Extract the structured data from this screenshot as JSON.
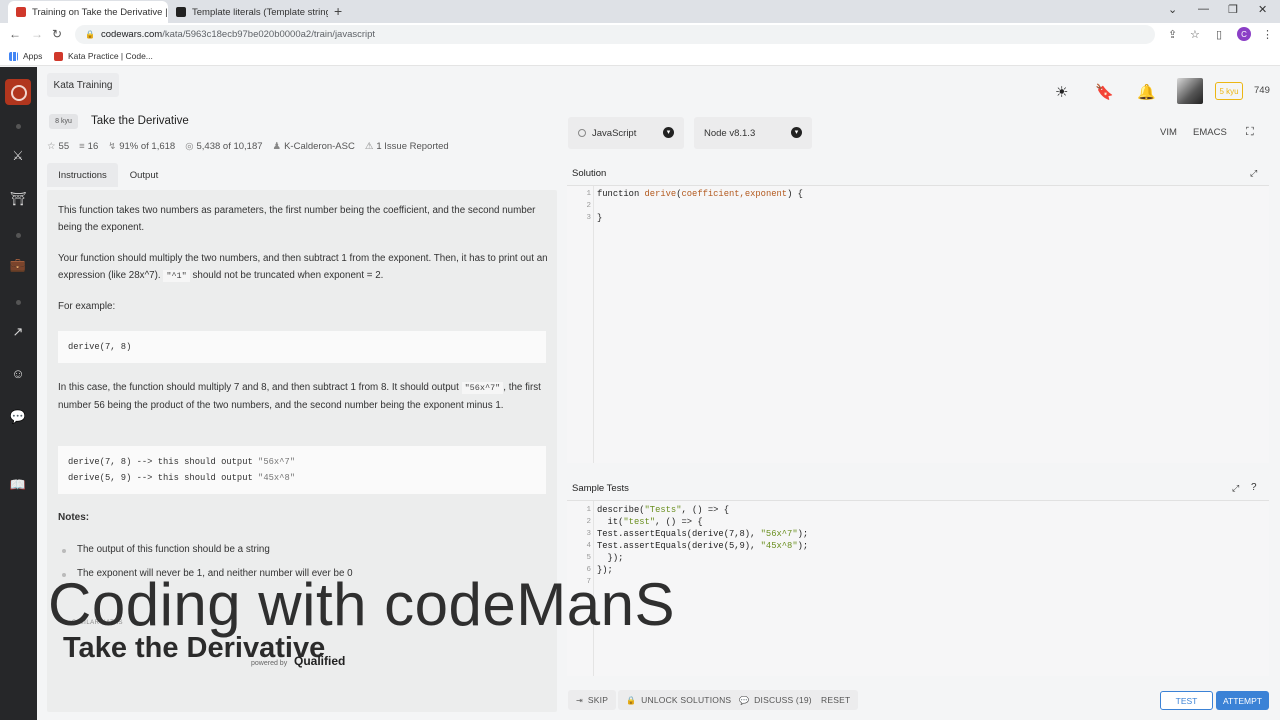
{
  "browser": {
    "tabs": [
      {
        "title": "Training on Take the Derivative |",
        "active": true,
        "color": "#d0382b"
      },
      {
        "title": "Template literals (Template string",
        "active": false,
        "color": "#222222"
      }
    ],
    "url_host": "codewars.com",
    "url_path": "/kata/5963c18ecb97be020b0000a2/train/javascript",
    "profile_initial": "C",
    "bookmarks": [
      {
        "label": "Apps"
      },
      {
        "label": "Kata Practice | Code..."
      }
    ]
  },
  "header": {
    "kata_training": "Kata Training",
    "rank_badge": "5 kyu",
    "honor": "749"
  },
  "kata": {
    "rank": "8 kyu",
    "title": "Take the Derivative",
    "stats": {
      "stars": "55",
      "collections": "16",
      "satisfaction": "91% of 1,618",
      "completed": "5,438 of 10,187",
      "author": "K-Calderon-ASC",
      "issues": "1 Issue Reported"
    },
    "tabs": {
      "instructions": "Instructions",
      "output": "Output"
    },
    "description": {
      "p1": "This function takes two numbers as parameters, the first number being the coefficient, and the second number being the exponent.",
      "p2_before": "Your function should multiply the two numbers, and then subtract 1 from the exponent. Then, it has to print out an expression (like 28x^7).",
      "p2_code": "\"^1\"",
      "p2_after": "should not be truncated when exponent = 2.",
      "for_example": "For example:",
      "code1": "derive(7, 8)",
      "p3_before": "In this case, the function should multiply 7 and 8, and then subtract 1 from 8. It should output",
      "p3_code": "\"56x^7\"",
      "p3_after": ", the first number 56 being the product of the two numbers, and the second number being the exponent minus 1.",
      "code2_line1_a": "derive(7, 8) --> this should output ",
      "code2_line1_b": "\"56x^7\"",
      "code2_line2_a": "derive(5, 9) --> this should output ",
      "code2_line2_b": "\"45x^8\"",
      "notes": "Notes:",
      "note1": "The output of this function should be a string",
      "note2": "The exponent will never be 1, and neither number will ever be 0",
      "similar": "SIMILAR KATAS"
    }
  },
  "editor": {
    "language": "JavaScript",
    "runtime": "Node v8.1.3",
    "mode_vim": "VIM",
    "mode_emacs": "EMACS",
    "solution_title": "Solution",
    "solution_lines": [
      {
        "num": "1",
        "a": "function ",
        "fn": "derive",
        "b": "(",
        "params": "coefficient,exponent",
        "c": ") {"
      },
      {
        "num": "2",
        "text": ""
      },
      {
        "num": "3",
        "text": "}"
      }
    ],
    "tests_title": "Sample Tests",
    "test_lines": [
      {
        "num": "1",
        "a": "describe(",
        "s": "\"Tests\"",
        "b": ", () => {"
      },
      {
        "num": "2",
        "a": "  it(",
        "s": "\"test\"",
        "b": ", () => {"
      },
      {
        "num": "3",
        "a": "Test.assertEquals(derive(7,8), ",
        "s": "\"56x^7\"",
        "b": ");"
      },
      {
        "num": "4",
        "a": "Test.assertEquals(derive(5,9), ",
        "s": "\"45x^8\"",
        "b": ");"
      },
      {
        "num": "5",
        "a": "  });",
        "s": "",
        "b": ""
      },
      {
        "num": "6",
        "a": "});",
        "s": "",
        "b": ""
      },
      {
        "num": "7",
        "a": "",
        "s": "",
        "b": ""
      }
    ]
  },
  "toolbar": {
    "skip": "SKIP",
    "unlock": "UNLOCK SOLUTIONS",
    "discuss": "DISCUSS (19)",
    "reset": "RESET",
    "test": "TEST",
    "attempt": "ATTEMPT"
  },
  "watermark": {
    "channel": "Coding with codeManS",
    "title": "Take the Derivative",
    "powered_by": "powered by",
    "qualified": "Qualified"
  }
}
